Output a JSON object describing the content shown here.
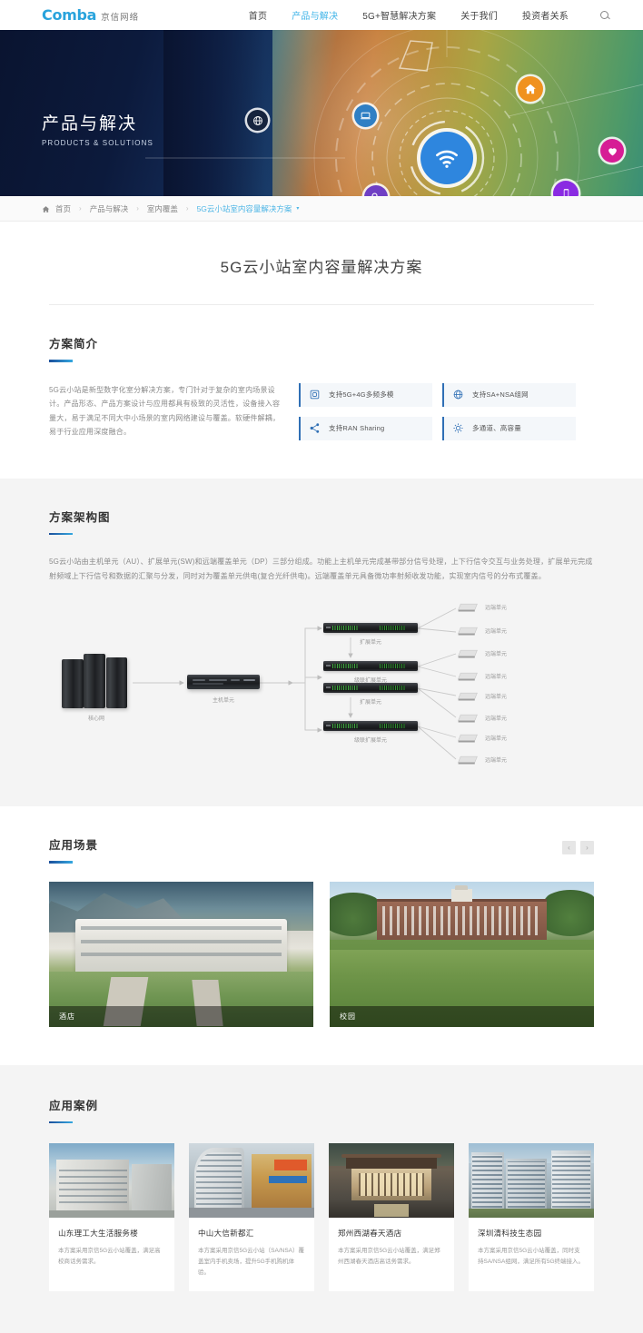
{
  "header": {
    "logo_text": "Comba",
    "logo_cn": "京信网络",
    "nav": [
      {
        "label": "首页",
        "active": false
      },
      {
        "label": "产品与解决",
        "active": true
      },
      {
        "label": "5G+智慧解决方案",
        "active": false
      },
      {
        "label": "关于我们",
        "active": false
      },
      {
        "label": "投资者关系",
        "active": false
      }
    ],
    "search_icon": "search-icon",
    "accent_color": "#3fb4e8"
  },
  "hero": {
    "title": "产品与解决",
    "subtitle": "PRODUCTS & SOLUTIONS",
    "icons": [
      {
        "name": "globe-icon",
        "color": "#1b2a47"
      },
      {
        "name": "laptop-icon",
        "color": "#2f7fc4"
      },
      {
        "name": "wifi-icon",
        "color": "#2e86de"
      },
      {
        "name": "home-icon",
        "color": "#f0921f"
      },
      {
        "name": "heart-icon",
        "color": "#d61d95"
      },
      {
        "name": "phone-icon",
        "color": "#8a2be2"
      },
      {
        "name": "gears-icon",
        "color": "#6f3fc4"
      }
    ]
  },
  "breadcrumb": {
    "home_icon": "home-icon",
    "items": [
      "首页",
      "产品与解决",
      "室内覆盖"
    ],
    "current": "5G云小站室内容量解决方案",
    "separator": "›",
    "caret": "▾"
  },
  "page": {
    "title": "5G云小站室内容量解决方案"
  },
  "intro": {
    "heading": "方案简介",
    "paragraph": "5G云小站是新型数字化室分解决方案，专门针对于复杂的室内场景设计。产品形态、产品方案设计与应用都具有极致的灵活性，设备接入容量大，易于满足不同大中小场景的室内网络建设与覆盖。软硬件解耦，易于行业应用深度融合。",
    "features": [
      {
        "label": "支持5G+4G多频多模",
        "icon": "chip-icon"
      },
      {
        "label": "支持SA+NSA组网",
        "icon": "globe-network-icon"
      },
      {
        "label": "支持RAN Sharing",
        "icon": "share-nodes-icon"
      },
      {
        "label": "多通道、高容量",
        "icon": "sun-channel-icon"
      }
    ]
  },
  "architecture": {
    "heading": "方案架构图",
    "paragraph": "5G云小站由主机单元（AU）、扩展单元(SW)和远端覆盖单元（DP）三部分组成。功能上主机单元完成基带部分信号处理，上下行信令交互与业务处理，扩展单元完成射频域上下行信号和数据的汇聚与分发，同时对为覆盖单元供电(复合光纤供电)。远端覆盖单元具备微功率射频收发功能，实现室内信号的分布式覆盖。",
    "labels": {
      "core_network": "核心网",
      "host_unit": "主机单元",
      "expansion_unit": "扩展单元",
      "cascade_expansion_unit": "级联扩展单元",
      "remote_unit": "远端单元"
    },
    "remote_unit_count": 8
  },
  "scenes": {
    "heading": "应用场景",
    "prev_label": "‹",
    "next_label": "›",
    "cards": [
      {
        "caption": "酒店",
        "image": "hotel-photo"
      },
      {
        "caption": "校园",
        "image": "campus-photo"
      }
    ]
  },
  "cases": {
    "heading": "应用案例",
    "cards": [
      {
        "title": "山东理工大生活服务楼",
        "desc": "本方案采用京信5G云小站覆盖，满足高校商话务需求。",
        "image": "shandong-building-photo"
      },
      {
        "title": "中山大信新都汇",
        "desc": "本方案采用京信5G云小站（SA/NSA）覆盖室内手机卖场，提升5G手机购机体验。",
        "image": "zhongshan-mall-photo"
      },
      {
        "title": "郑州西湖春天酒店",
        "desc": "本方案采用京信5G云小站覆盖，满足郑州西湖春天酒店高话务需求。",
        "image": "zhengzhou-hotel-photo"
      },
      {
        "title": "深圳清科技生态园",
        "desc": "本方案采用京信5G云小站覆盖，同时支持SA/NSA组网，满足所有5G终端接入。",
        "image": "shenzhen-park-photo"
      }
    ]
  }
}
